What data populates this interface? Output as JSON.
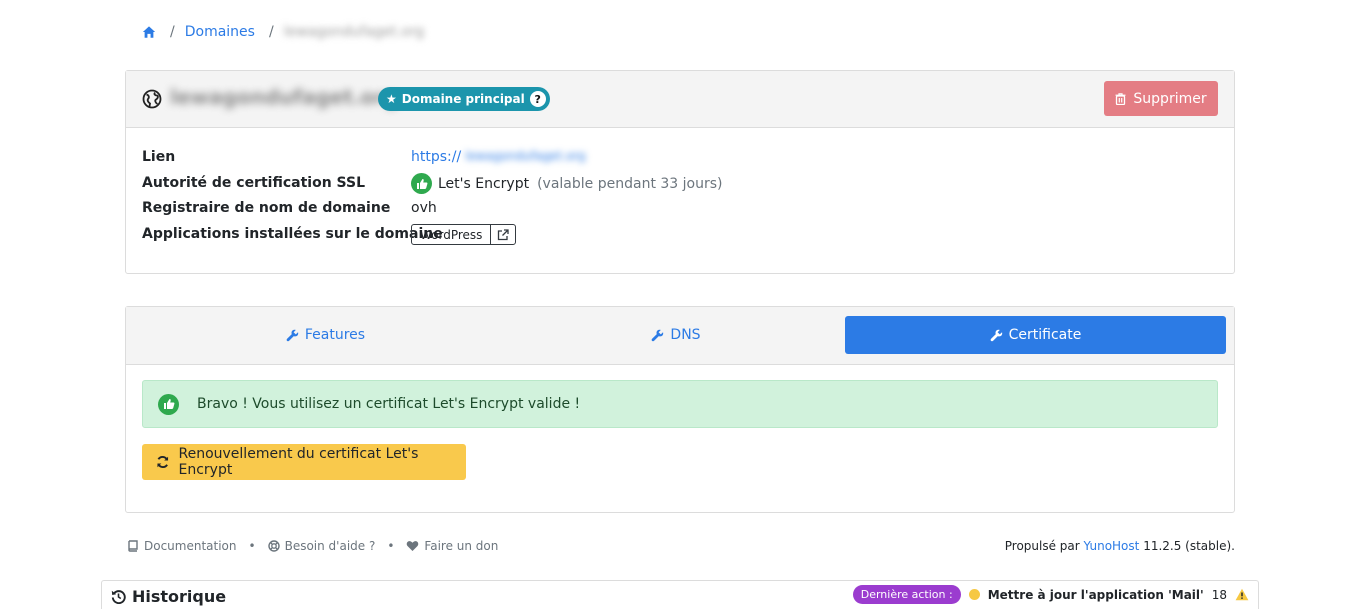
{
  "breadcrumb": {
    "home_icon": "home-icon",
    "domains_label": "Domaines",
    "current_domain": "lewagondufaget.org"
  },
  "domain_card": {
    "domain_name": "lewagondufaget.org",
    "main_badge_label": "Domaine principal",
    "main_badge_help": "?",
    "delete_label": "Supprimer",
    "rows": {
      "link_label": "Lien",
      "link_prefix": "https://",
      "link_domain": "lewagondufaget.org",
      "ssl_label": "Autorité de certification SSL",
      "ssl_value": "Let's Encrypt",
      "ssl_validity": "(valable pendant 33 jours)",
      "registrar_label": "Registraire de nom de domaine",
      "registrar_value": "ovh",
      "apps_label": "Applications installées sur le domaine",
      "app_name": "WordPress"
    }
  },
  "tabs": [
    {
      "label": "Features",
      "active": false
    },
    {
      "label": "DNS",
      "active": false
    },
    {
      "label": "Certificate",
      "active": true
    }
  ],
  "certificate": {
    "alert_text": "Bravo ! Vous utilisez un certificat Let's Encrypt valide !",
    "renew_label": "Renouvellement du certificat Let's Encrypt"
  },
  "footer": {
    "documentation": "Documentation",
    "help": "Besoin d'aide ?",
    "donate": "Faire un don",
    "separator": "•",
    "powered_by": "Propulsé par",
    "brand": "YunoHost",
    "version": "11.2.5 (stable)."
  },
  "history": {
    "title": "Historique",
    "last_action_label": "Dernière action :",
    "last_action_text": "Mettre à jour l'application 'Mail'",
    "count": "18"
  },
  "colors": {
    "primary": "#2c7be5",
    "success": "#2fa94e",
    "danger_soft": "#e47d84",
    "warning": "#f9c94c",
    "info": "#1c95ac",
    "purple": "#9b3ccf"
  }
}
